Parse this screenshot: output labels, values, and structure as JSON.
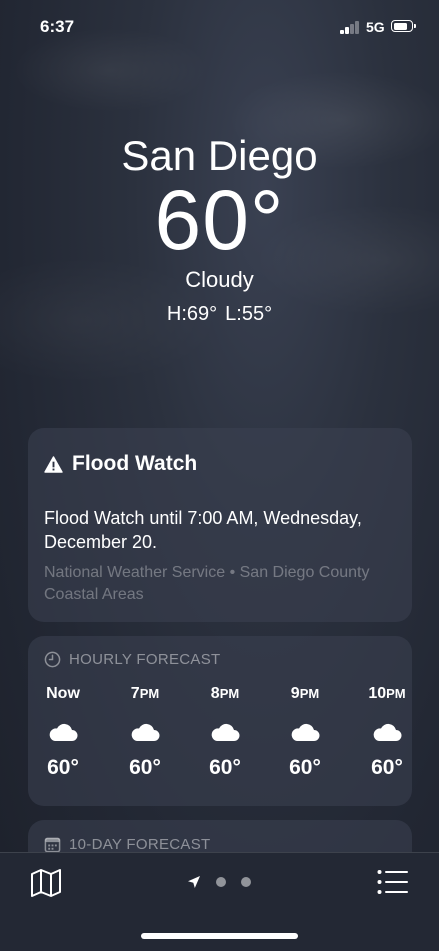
{
  "status_bar": {
    "time": "6:37",
    "network": "5G"
  },
  "hero": {
    "city": "San Diego",
    "temperature": "60°",
    "condition": "Cloudy",
    "high": "H:69°",
    "low": "L:55°"
  },
  "alert": {
    "icon": "warning-triangle-icon",
    "title": "Flood Watch",
    "body": "Flood Watch until 7:00 AM, Wednesday, December 20.",
    "source": "National Weather Service • San Diego County Coastal Areas"
  },
  "hourly": {
    "header": "HOURLY FORECAST",
    "icon": "clock-icon",
    "hours": [
      {
        "time": "Now",
        "suffix": "",
        "icon": "cloud-icon",
        "temp": "60°"
      },
      {
        "time": "7",
        "suffix": "PM",
        "icon": "cloud-icon",
        "temp": "60°"
      },
      {
        "time": "8",
        "suffix": "PM",
        "icon": "cloud-icon",
        "temp": "60°"
      },
      {
        "time": "9",
        "suffix": "PM",
        "icon": "cloud-icon",
        "temp": "60°"
      },
      {
        "time": "10",
        "suffix": "PM",
        "icon": "cloud-icon",
        "temp": "60°"
      }
    ]
  },
  "tenday": {
    "header": "10-DAY FORECAST",
    "icon": "calendar-icon"
  },
  "bottom_bar": {
    "map_icon": "map-icon",
    "location_icon": "location-arrow-icon",
    "page_dots": 2,
    "list_icon": "list-icon"
  },
  "colors": {
    "card": "#3c4252",
    "bar": "#232834",
    "muted": "#8a8f99"
  }
}
